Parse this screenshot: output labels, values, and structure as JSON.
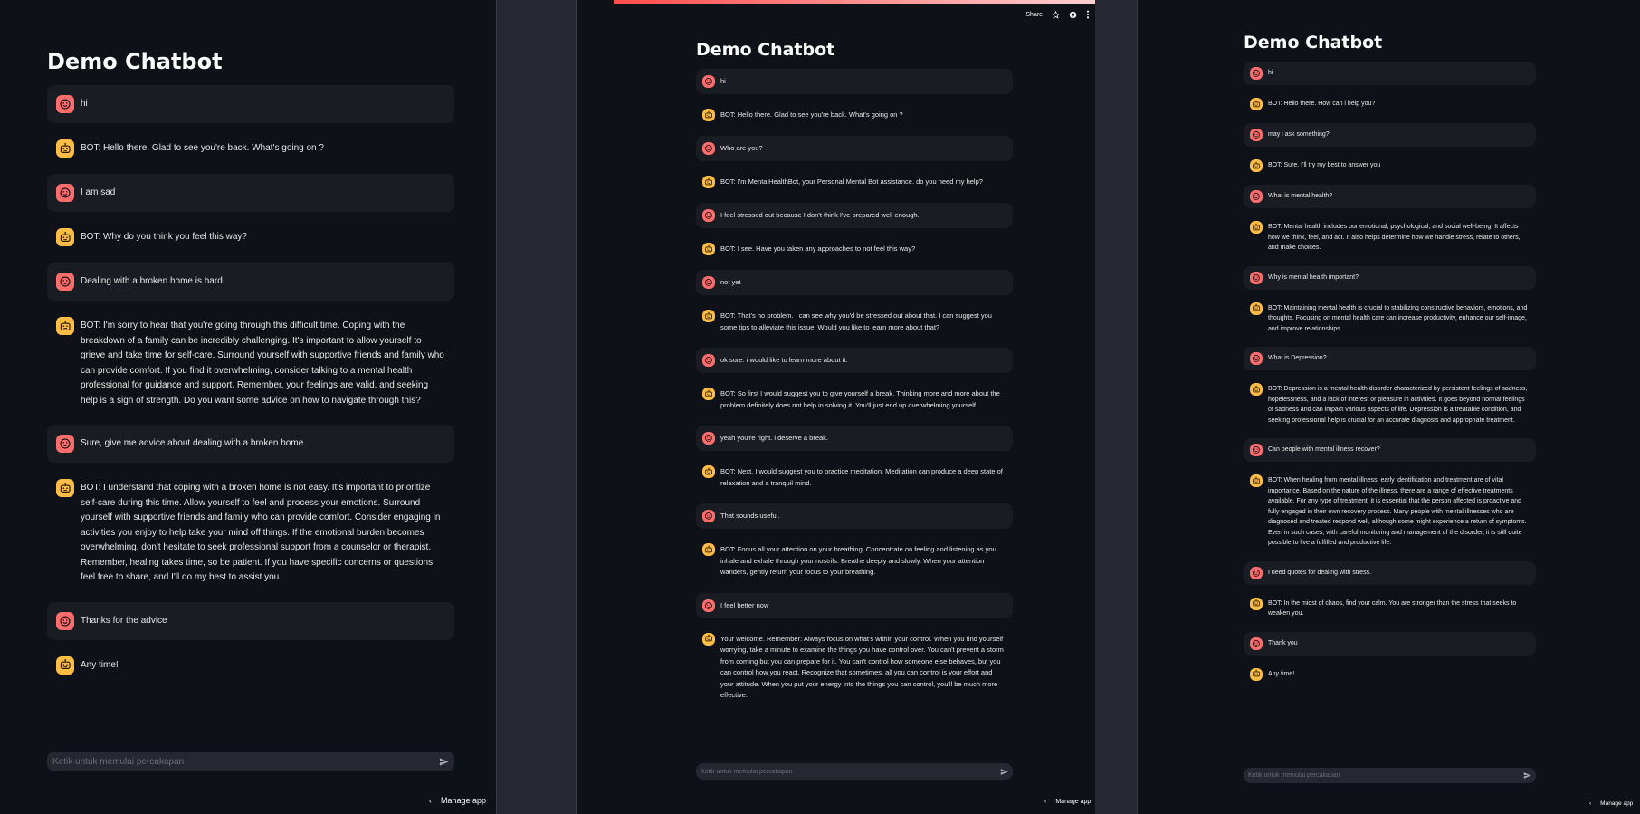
{
  "colors": {
    "user_avatar": "#ff6c6c",
    "bot_avatar": "#ffbd45",
    "background": "#0e1117",
    "user_bubble": "#1a1c24"
  },
  "panels": [
    {
      "title": "Demo Chatbot",
      "messages": [
        {
          "role": "user",
          "text": "hi"
        },
        {
          "role": "bot",
          "text": "BOT: Hello there. Glad to see you're back. What's going on ?"
        },
        {
          "role": "user",
          "text": "I am sad"
        },
        {
          "role": "bot",
          "text": "BOT: Why do you think you feel this way?"
        },
        {
          "role": "user",
          "text": "Dealing with a broken home is hard."
        },
        {
          "role": "bot",
          "text": "BOT: I'm sorry to hear that you're going through this difficult time. Coping with the breakdown of a family can be incredibly challenging. It's important to allow yourself to grieve and take time for self-care. Surround yourself with supportive friends and family who can provide comfort. If you find it overwhelming, consider talking to a mental health professional for guidance and support. Remember, your feelings are valid, and seeking help is a sign of strength. Do you want some advice on how to navigate through this?"
        },
        {
          "role": "user",
          "text": "Sure, give me advice about dealing with a broken home."
        },
        {
          "role": "bot",
          "text": "BOT: I understand that coping with a broken home is not easy. It's important to prioritize self-care during this time. Allow yourself to feel and process your emotions. Surround yourself with supportive friends and family who can provide comfort. Consider engaging in activities you enjoy to help take your mind off things. If the emotional burden becomes overwhelming, don't hesitate to seek professional support from a counselor or therapist. Remember, healing takes time, so be patient. If you have specific concerns or questions, feel free to share, and I'll do my best to assist you."
        },
        {
          "role": "user",
          "text": "Thanks for the advice"
        },
        {
          "role": "bot",
          "text": "Any time!"
        }
      ],
      "input_placeholder": "Ketik untuk memulai percakapan",
      "manage_label": "Manage app"
    },
    {
      "title": "Demo Chatbot",
      "toolbar": {
        "share": "Share"
      },
      "messages": [
        {
          "role": "user",
          "text": "hi"
        },
        {
          "role": "bot",
          "text": "BOT: Hello there. Glad to see you're back. What's going on ?"
        },
        {
          "role": "user",
          "text": "Who are you?"
        },
        {
          "role": "bot",
          "text": "BOT: I'm MentalHealthBot, your Personal Mental Bot assistance. do you need my help?"
        },
        {
          "role": "user",
          "text": "I feel stressed out because I don't think I've prepared well enough."
        },
        {
          "role": "bot",
          "text": "BOT: I see. Have you taken any approaches to not feel this way?"
        },
        {
          "role": "user",
          "text": "not yet"
        },
        {
          "role": "bot",
          "text": "BOT: That's no problem. I can see why you'd be stressed out about that. I can suggest you some tips to alleviate this issue. Would you like to learn more about that?"
        },
        {
          "role": "user",
          "text": "ok sure. i would like to learn more about it."
        },
        {
          "role": "bot",
          "text": "BOT: So first I would suggest you to give yourself a break. Thinking more and more about the problem definitely does not help in solving it. You'll just end up overwhelming yourself."
        },
        {
          "role": "user",
          "text": "yeah you're right. i deserve a break."
        },
        {
          "role": "bot",
          "text": "BOT: Next, I would suggest you to practice meditation. Meditation can produce a deep state of relaxation and a tranquil mind."
        },
        {
          "role": "user",
          "text": "That sounds useful."
        },
        {
          "role": "bot",
          "text": "BOT: Focus all your attention on your breathing. Concentrate on feeling and listening as you inhale and exhale through your nostrils. Breathe deeply and slowly. When your attention wanders, gently return your focus to your breathing."
        },
        {
          "role": "user",
          "text": "I feel better now"
        },
        {
          "role": "bot",
          "text": "Your welcome. Remember: Always focus on what's within your control. When you find yourself worrying, take a minute to examine the things you have control over. You can't prevent a storm from coming but you can prepare for it. You can't control how someone else behaves, but you can control how you react. Recognize that sometimes, all you can control is your effort and your attitude. When you put your energy into the things you can control, you'll be much more effective."
        }
      ],
      "input_placeholder": "Ketik untuk memulai percakapan",
      "manage_label": "Manage app"
    },
    {
      "title": "Demo Chatbot",
      "messages": [
        {
          "role": "user",
          "text": "hi"
        },
        {
          "role": "bot",
          "text": "BOT: Hello there. How can i help you?"
        },
        {
          "role": "user",
          "text": "may i ask something?"
        },
        {
          "role": "bot",
          "text": "BOT: Sure. I'll try my best to answer you"
        },
        {
          "role": "user",
          "text": "What is mental health?"
        },
        {
          "role": "bot",
          "text": "BOT: Mental health includes our emotional, psychological, and social well-being. It affects how we think, feel, and act. It also helps determine how we handle stress, relate to others, and make choices."
        },
        {
          "role": "user",
          "text": "Why is mental health important?"
        },
        {
          "role": "bot",
          "text": "BOT: Maintaining mental health is crucial to stabilizing constructive behaviors, emotions, and thoughts. Focusing on mental health care can increase productivity, enhance our self-image, and improve relationships."
        },
        {
          "role": "user",
          "text": "What is Depression?"
        },
        {
          "role": "bot",
          "text": "BOT: Depression is a mental health disorder characterized by persistent feelings of sadness, hopelessness, and a lack of interest or pleasure in activities. It goes beyond normal feelings of sadness and can impact various aspects of life. Depression is a treatable condition, and seeking professional help is crucial for an accurate diagnosis and appropriate treatment."
        },
        {
          "role": "user",
          "text": "Can people with mental illness recover?"
        },
        {
          "role": "bot",
          "text": "BOT: When healing from mental illness, early identification and treatment are of vital importance. Based on the nature of the illness, there are a range of effective treatments available. For any type of treatment, it is essential that the person affected is proactive and fully engaged in their own recovery process. Many people with mental illnesses who are diagnosed and treated respond well, although some might experience a return of symptoms. Even in such cases, with careful monitoring and management of the disorder, it is still quite possible to live a fulfilled and productive life."
        },
        {
          "role": "user",
          "text": "I need quotes for dealing with stress."
        },
        {
          "role": "bot",
          "text": "BOT: In the midst of chaos, find your calm. You are stronger than the stress that seeks to weaken you."
        },
        {
          "role": "user",
          "text": "Thank you"
        },
        {
          "role": "bot",
          "text": "Any time!"
        }
      ],
      "input_placeholder": "Ketik untuk memulai percakapan",
      "manage_label": "Manage app"
    }
  ]
}
